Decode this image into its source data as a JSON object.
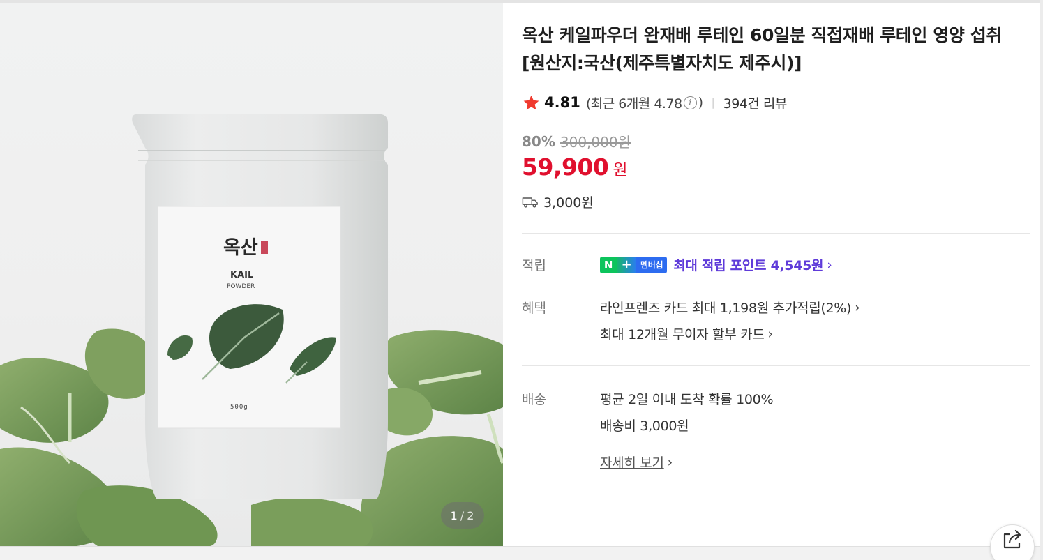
{
  "product": {
    "title": "옥산 케일파우더 완재배 루테인 60일분 직접재배 루테인 영양 섭취 [원산지:국산(제주특별자치도 제주시)]",
    "rating": "4.81",
    "recent_label": "(최근 6개월 4.78",
    "recent_close": ")",
    "info_icon": "i",
    "review_count": "394건 리뷰",
    "discount_rate": "80%",
    "original_price": "300,000원",
    "price": "59,900",
    "currency": "원",
    "shipping_fee": "3,000원"
  },
  "gallery": {
    "current": "1",
    "separator": "/",
    "total": "2",
    "package": {
      "brand": "옥산",
      "name_line1": "KAIL",
      "name_line2": "POWDER",
      "weight": "500g"
    }
  },
  "benefits": {
    "points_label": "적립",
    "badge_n": "N",
    "badge_plus": "+",
    "badge_membership": "멤버십",
    "points_text": "최대 적립 포인트 4,545원",
    "perks_label": "혜택",
    "perk1": "라인프렌즈 카드 최대 1,198원 추가적립(2%)",
    "perk2": "최대 12개월 무이자 할부 카드",
    "delivery_label": "배송",
    "delivery1": "평균 2일 이내 도착 확률 100%",
    "delivery2": "배송비 3,000원",
    "detail_link": "자세히 보기",
    "chevron": "›"
  },
  "colors": {
    "price_red": "#e0102e",
    "points_purple": "#5f3bd9",
    "naver_green": "#0cc45c",
    "star": "#f03a2e"
  },
  "icons": [
    "star-icon",
    "info-icon",
    "truck-icon",
    "share-icon",
    "chevron-right-icon"
  ]
}
